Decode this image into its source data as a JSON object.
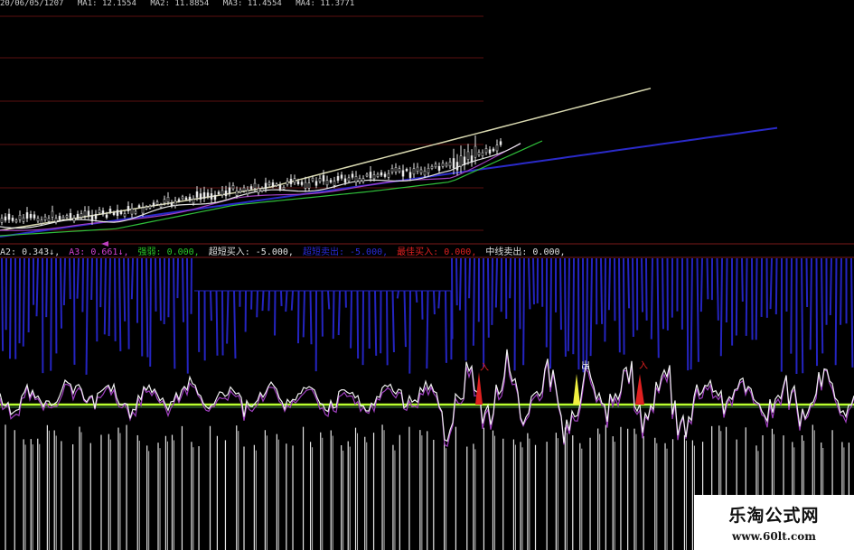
{
  "top_readout": {
    "items": [
      "20/06/05/1207",
      "MA1: 12.1554",
      "MA2: 11.8854",
      "MA3: 11.4554",
      "MA4: 11.3771"
    ]
  },
  "indicator_bar": {
    "items": [
      {
        "text": "A2: 0.343↓,",
        "color": "#d8d8d8"
      },
      {
        "text": "A3: 0.661↓,",
        "color": "#d040d0"
      },
      {
        "text": "强弱: 0.000,",
        "color": "#28c828"
      },
      {
        "text": "超短买入: -5.000,",
        "color": "#e0e0e0"
      },
      {
        "text": "超短卖出: -5.000,",
        "color": "#2a2ad8"
      },
      {
        "text": "最佳买入: 0.000,",
        "color": "#e02020"
      },
      {
        "text": "中线卖出: 0.000,",
        "color": "#e0e0e0"
      }
    ]
  },
  "signals": {
    "buy_label_1": "入",
    "sell_label": "出",
    "buy_label_2": "入"
  },
  "watermark": {
    "title": "乐淘公式网",
    "url": "www.60lt.com"
  },
  "colors": {
    "background": "#000000",
    "candle": "#e8e8e8",
    "ma_white": "#e6e6e6",
    "ma_purple": "#a040c0",
    "ma_green": "#2fbf3a",
    "ma_pale": "#d8d8b0",
    "ma_blue": "#2a2ac8",
    "bars_blue": "#2424c0",
    "threshold_line": "#b8ff30",
    "osc_white": "#f0f0f0",
    "osc_purple": "#a040c0",
    "signal_red": "#e02020",
    "signal_yellow": "#f0f040",
    "grid_red": "#5a1010"
  },
  "icons": [
    "cursor-marker-icon"
  ]
}
